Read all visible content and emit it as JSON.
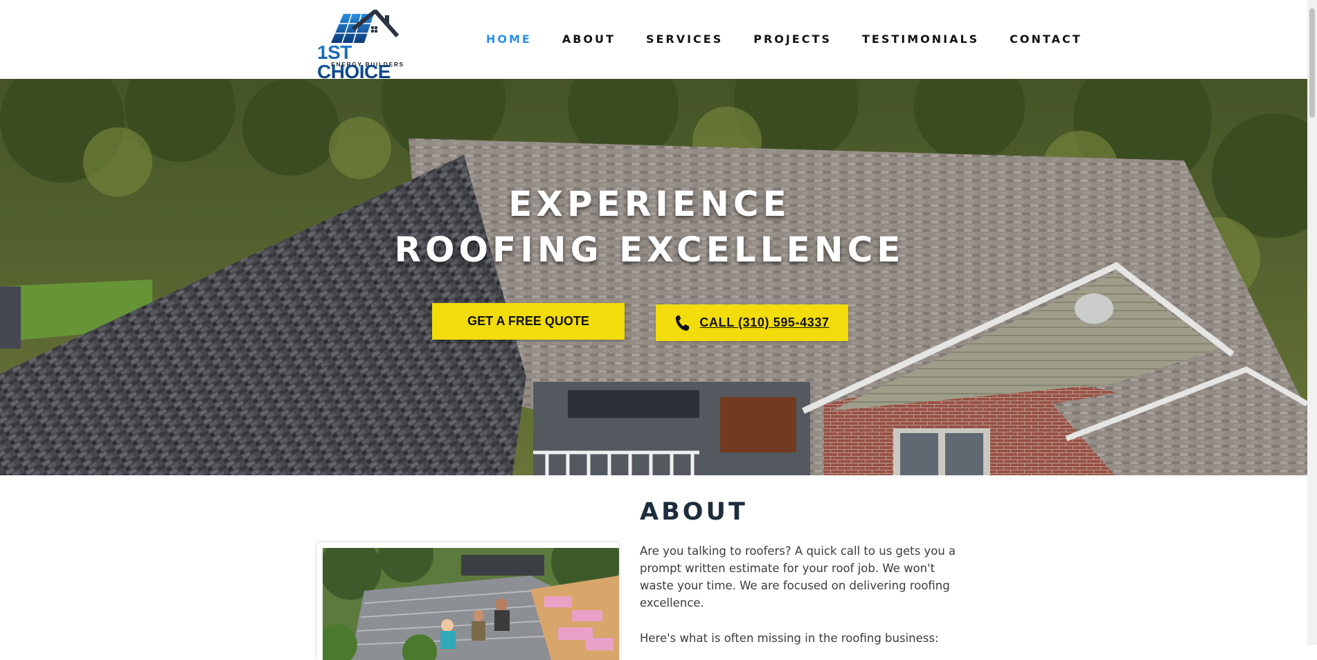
{
  "brand": {
    "name": "1ST CHOICE",
    "tagline": "ENERGY BUILDERS",
    "colors": {
      "blue": "#1d7fd1",
      "dark_navy": "#0b3a78"
    }
  },
  "nav": {
    "items": [
      {
        "label": "HOME",
        "active": true
      },
      {
        "label": "ABOUT",
        "active": false
      },
      {
        "label": "SERVICES",
        "active": false
      },
      {
        "label": "PROJECTS",
        "active": false
      },
      {
        "label": "TESTIMONIALS",
        "active": false
      },
      {
        "label": "CONTACT",
        "active": false
      }
    ],
    "active_color": "#2a90e6"
  },
  "hero": {
    "title_line1": "EXPERIENCE",
    "title_line2": "ROOFING EXCELLENCE",
    "quote_button": "GET A FREE QUOTE",
    "call_button": "CALL  (310) 595-4337",
    "call_icon": "phone-icon",
    "button_color": "#f2dc0b"
  },
  "about": {
    "title": "ABOUT",
    "paragraph1": "Are you talking to roofers?  A quick call to us gets you a prompt written estimate for your roof job.  We won't waste your time.  We are focused on delivering roofing excellence.",
    "paragraph2": "Here's what is often missing in the roofing business:"
  }
}
